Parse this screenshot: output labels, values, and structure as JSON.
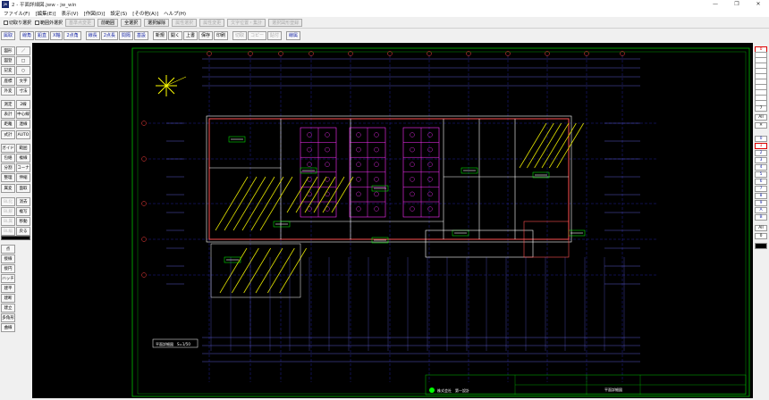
{
  "window": {
    "title": "2 - 平面詳細図.jww - jw_win",
    "app_icon": "jw",
    "controls": [
      "—",
      "❐",
      "✕"
    ]
  },
  "menu": [
    "ファイル(F)",
    "[編集(E)]",
    "表示(V)",
    "[作図(D)]",
    "設定(S)",
    "[その他(A)]",
    "ヘルプ(H)"
  ],
  "toolbar1": {
    "checkboxes": [
      "切取り選択",
      "範囲外選択"
    ],
    "buttons": [
      {
        "label": "基準点変更",
        "disabled": true
      },
      {
        "label": "前範囲",
        "disabled": false
      },
      {
        "label": "全選択",
        "disabled": false
      },
      {
        "label": "選択解除",
        "disabled": false
      },
      {
        "label": "属性選択",
        "disabled": true
      },
      {
        "label": "属性変更",
        "disabled": true
      },
      {
        "label": "文字位置・集計",
        "disabled": true
      },
      {
        "label": "選択図形登録",
        "disabled": true
      }
    ]
  },
  "toolbar2": [
    {
      "label": "属取",
      "style": "blue"
    },
    {
      "label": "線角",
      "style": "blue",
      "gap": true
    },
    {
      "label": "鉛直",
      "style": "blue"
    },
    {
      "label": "X軸",
      "style": "blue"
    },
    {
      "label": "2点角",
      "style": "blue"
    },
    {
      "label": "線長",
      "style": "blue",
      "gap": true
    },
    {
      "label": "2点長",
      "style": "blue"
    },
    {
      "label": "間隔",
      "style": "blue"
    },
    {
      "label": "基設",
      "style": "blue"
    },
    {
      "label": "新規",
      "style": "normal",
      "gap": true
    },
    {
      "label": "開く",
      "style": "normal"
    },
    {
      "label": "上書",
      "style": "normal"
    },
    {
      "label": "保存",
      "style": "normal"
    },
    {
      "label": "印刷",
      "style": "normal"
    },
    {
      "label": "切取",
      "style": "dis",
      "gap": true
    },
    {
      "label": "コピー",
      "style": "dis"
    },
    {
      "label": "貼付",
      "style": "dis"
    },
    {
      "label": "線属",
      "style": "blue",
      "gap": true
    }
  ],
  "left_tools": {
    "col1": [
      "点",
      "接線",
      "接円",
      "ハッチ",
      "建平",
      "建断",
      "建立",
      "多角形",
      "曲線"
    ],
    "col2": [
      "連続",
      "面取",
      "消去",
      "複写",
      "移動",
      "戻る"
    ],
    "top_col1": [
      "図形",
      "図登",
      "記変",
      "座標",
      "外変",
      "測定",
      "表計",
      "距離",
      "式計",
      "ガイド",
      "包絡",
      "分割",
      "整理",
      "属変",
      "BL化",
      "BL解",
      "BL属",
      "BL編"
    ],
    "top_col2": [
      "／",
      "□",
      "○",
      "文字",
      "寸法",
      "2線",
      "中心線",
      "連線",
      "AUTO",
      "範囲",
      "複線",
      "コーナー",
      "伸縮",
      "面取",
      "消去",
      "複写",
      "移動",
      "戻る"
    ]
  },
  "layers": {
    "group_top": [
      "0",
      "",
      "",
      "",
      "",
      "",
      "",
      "",
      "",
      "",
      "",
      "7"
    ],
    "all_label": "All",
    "x_label": "✕",
    "group_bottom": [
      "0",
      "1",
      "2",
      "3",
      "4",
      "5",
      "6",
      "7",
      "8",
      "9",
      "A",
      "B"
    ],
    "all_label2": "All",
    "bottom_val": "0"
  },
  "drawing": {
    "scale_label": "平面詳細図　S=1/50",
    "titleblock_company": "株式会社　第一設計",
    "titleblock_name": "平面詳細図",
    "room_labels": [
      "事務室",
      "会議室",
      "倉庫",
      "更衣室",
      "便所",
      "機械室",
      "玄関ホール",
      "廊下"
    ]
  }
}
